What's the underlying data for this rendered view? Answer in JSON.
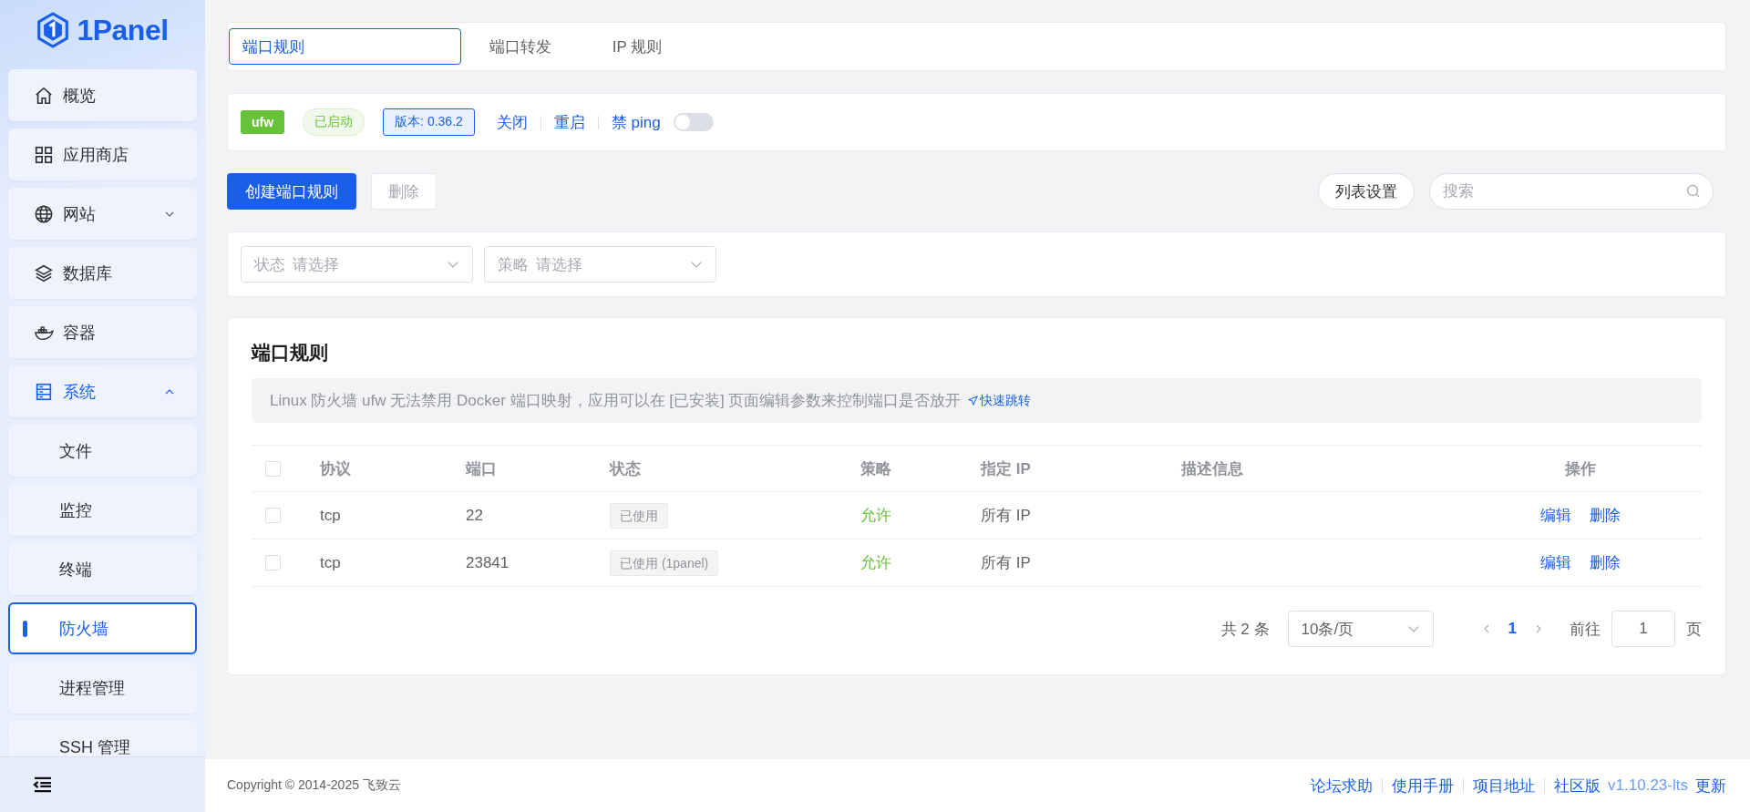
{
  "sidebar": {
    "logo": "1Panel",
    "items": [
      {
        "label": "概览",
        "selected": false
      },
      {
        "label": "应用商店",
        "selected": false
      },
      {
        "label": "网站",
        "selected": false,
        "expanded": false
      },
      {
        "label": "数据库",
        "selected": false
      },
      {
        "label": "容器",
        "selected": false
      },
      {
        "label": "系统",
        "selected": false,
        "expanded": true,
        "children": [
          {
            "label": "文件",
            "selected": false
          },
          {
            "label": "监控",
            "selected": false
          },
          {
            "label": "终端",
            "selected": false
          },
          {
            "label": "防火墙",
            "selected": true
          },
          {
            "label": "进程管理",
            "selected": false
          },
          {
            "label": "SSH 管理",
            "selected": false
          }
        ]
      }
    ]
  },
  "tabs": [
    {
      "label": "端口规则",
      "selected": true
    },
    {
      "label": "端口转发",
      "selected": false
    },
    {
      "label": "IP 规则",
      "selected": false
    }
  ],
  "firewall": {
    "name": "ufw",
    "status": "已启动",
    "version": "版本: 0.36.2",
    "actions": [
      "关闭",
      "重启"
    ],
    "ping_label": "禁 ping",
    "ping_on": false
  },
  "toolbar": {
    "create": "创建端口规则",
    "delete": "删除",
    "delete_disabled": true,
    "list_settings": "列表设置",
    "search_placeholder": "搜索"
  },
  "filters": [
    {
      "label": "状态",
      "placeholder": "请选择"
    },
    {
      "label": "策略",
      "placeholder": "请选择"
    }
  ],
  "rules": {
    "title": "端口规则",
    "notice": "Linux 防火墙 ufw 无法禁用 Docker 端口映射，应用可以在 [已安装] 页面编辑参数来控制端口是否放开",
    "notice_link": "快速跳转",
    "columns": [
      "协议",
      "端口",
      "状态",
      "策略",
      "指定 IP",
      "描述信息",
      "操作"
    ],
    "all_checked": false,
    "rows": [
      {
        "checked": false,
        "protocol": "tcp",
        "port": "22",
        "status": "已使用",
        "strategy": "允许",
        "allowed": true,
        "address": "所有 IP",
        "actions": [
          "编辑",
          "删除"
        ]
      },
      {
        "checked": false,
        "protocol": "tcp",
        "port": "23841",
        "status": "已使用 (1panel)",
        "strategy": "允许",
        "allowed": true,
        "address": "所有 IP",
        "actions": [
          "编辑",
          "删除"
        ]
      }
    ]
  },
  "pagination": {
    "total": "共 2 条",
    "page_size": "10条/页",
    "pages": [
      {
        "label": "1",
        "selected": true
      }
    ],
    "goto_label": "前往",
    "goto_value": "1",
    "page_suffix": "页"
  },
  "footer": {
    "copyright": "Copyright © 2014-2025 飞致云",
    "links": [
      "论坛求助",
      "使用手册",
      "项目地址",
      "社区版"
    ],
    "version": "v1.10.23-lts",
    "update": "更新"
  }
}
